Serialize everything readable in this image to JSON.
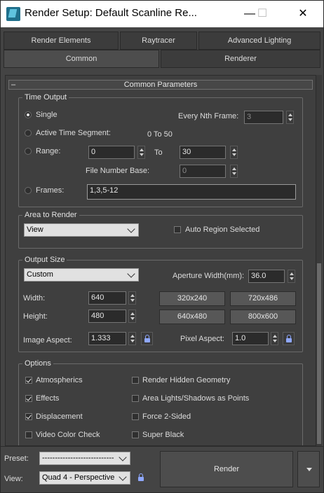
{
  "window": {
    "title": "Render Setup: Default Scanline Re...",
    "minimize": "—",
    "maximize": "☐",
    "close": "✕"
  },
  "tabs": {
    "row1": [
      "Render Elements",
      "Raytracer",
      "Advanced Lighting"
    ],
    "row2": [
      "Common",
      "Renderer"
    ],
    "active": "Common"
  },
  "common_parameters": {
    "rollout_title": "Common Parameters",
    "rollout_toggle": "–",
    "time_output": {
      "title": "Time Output",
      "single": "Single",
      "every_nth_label": "Every Nth Frame:",
      "every_nth_value": "3",
      "active_segment": "Active Time Segment:",
      "active_segment_range": "0 To 50",
      "range": "Range:",
      "range_from": "0",
      "range_to_label": "To",
      "range_to": "30",
      "file_number_base_label": "File Number Base:",
      "file_number_base": "0",
      "frames": "Frames:",
      "frames_value": "1,3,5-12",
      "selected": "Single"
    },
    "area_to_render": {
      "title": "Area to Render",
      "mode": "View",
      "auto_region": "Auto Region Selected",
      "auto_region_checked": false
    },
    "output_size": {
      "title": "Output Size",
      "preset": "Custom",
      "aperture_label": "Aperture Width(mm):",
      "aperture_value": "36.0",
      "width_label": "Width:",
      "width_value": "640",
      "height_label": "Height:",
      "height_value": "480",
      "presets": [
        "320x240",
        "720x486",
        "640x480",
        "800x600"
      ],
      "image_aspect_label": "Image Aspect:",
      "image_aspect_value": "1.333",
      "pixel_aspect_label": "Pixel Aspect:",
      "pixel_aspect_value": "1.0"
    },
    "options": {
      "title": "Options",
      "left": [
        {
          "label": "Atmospherics",
          "checked": true
        },
        {
          "label": "Effects",
          "checked": true
        },
        {
          "label": "Displacement",
          "checked": true
        },
        {
          "label": "Video Color Check",
          "checked": false
        }
      ],
      "right": [
        {
          "label": "Render Hidden Geometry",
          "checked": false
        },
        {
          "label": "Area Lights/Shadows as Points",
          "checked": false
        },
        {
          "label": "Force 2-Sided",
          "checked": false
        },
        {
          "label": "Super Black",
          "checked": false
        }
      ]
    }
  },
  "bottom": {
    "preset_label": "Preset:",
    "preset_value": "----------------------------",
    "view_label": "View:",
    "view_value": "Quad 4 - Perspective",
    "render_button": "Render"
  }
}
